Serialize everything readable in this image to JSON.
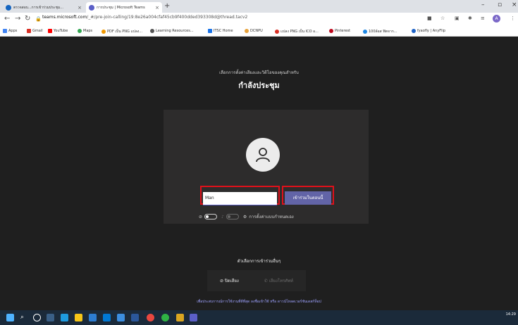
{
  "browser": {
    "tabs": [
      {
        "label": "ตรวจสอบ...การเข้าร่วมประชุม...",
        "active": false
      },
      {
        "label": "การประชุม | Microsoft Teams",
        "active": true
      }
    ],
    "url_domain": "teams.microsoft.com",
    "url_path": "/_#/pre-join-calling/19:8e26a004cfaf45cb9f400dded393308d@thread.tacv2",
    "bookmarks": [
      "Apps",
      "Gmail",
      "YouTube",
      "Maps",
      "PDF เป็น PNG แปลง...",
      "Learning Resources...",
      "ITSC Home",
      "DCNPU",
      "แปลง PNG เป็น ICO อ...",
      "Pinterest",
      "100ล้อส ฟิตจาก...",
      "fyaofly | AnyFlip"
    ]
  },
  "prejoin": {
    "subtitle": "เลือกการตั้งค่าเสียงและวิดีโอของคุณสำหรับ",
    "title": "กำลังประชุม",
    "name_value": "Man",
    "join_label": "เข้าร่วมในตอนนี้",
    "device_settings_label": "การตั้งค่าแบบกำหนดเอง"
  },
  "other_options": {
    "heading": "ตัวเลือกการเข้าร่วมอื่นๆ",
    "audio_off_label": "ปิดเสียง",
    "phone_label": "เสียงโทรศัพท์",
    "footer": "เพื่อประสบการณ์การใช้งานที่ดีที่สุด ลงชื่อเข้าใช้ หรือ ดาวน์โหลดเวอร์ชันเดสก์ท็อป"
  },
  "taskbar": {
    "time": "14:29"
  },
  "colors": {
    "teams_purple": "#6264a7",
    "highlight_red": "#e0101a",
    "background": "#1f1f1f"
  }
}
